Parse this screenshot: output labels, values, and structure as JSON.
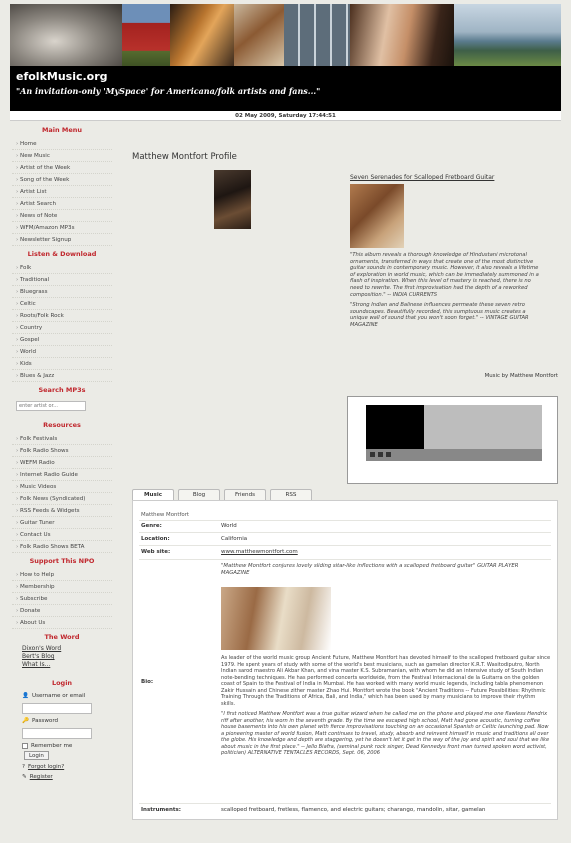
{
  "header": {
    "site_name": "efolkMusic.org",
    "tagline": "\"An invitation-only 'MySpace' for Americana/folk artists and fans...\"",
    "date": "02 May 2009, Saturday 17:44:51"
  },
  "sidebar": {
    "main_menu": {
      "title": "Main Menu",
      "items": [
        "Home",
        "New Music",
        "Artist of the Week",
        "Song of the Week",
        "Artist List",
        "Artist Search",
        "News of Note",
        "WFM/Amazon MP3s",
        "Newsletter Signup"
      ]
    },
    "listen": {
      "title": "Listen & Download",
      "items": [
        "Folk",
        "Traditional",
        "Bluegrass",
        "Celtic",
        "Roots/Folk Rock",
        "Country",
        "Gospel",
        "World",
        "Kids",
        "Blues & Jazz"
      ]
    },
    "search": {
      "title": "Search MP3s",
      "placeholder": "enter artist or..."
    },
    "resources": {
      "title": "Resources",
      "items": [
        "Folk Festivals",
        "Folk Radio Shows",
        "WEFM Radio",
        "Internet Radio Guide",
        "Music Videos",
        "Folk News (Syndicated)",
        "RSS Feeds & Widgets",
        "Guitar Tuner",
        "Contact Us",
        "Folk Radio Shows BETA"
      ]
    },
    "support": {
      "title": "Support This NPO",
      "items": [
        "How to Help",
        "Membership",
        "Subscribe",
        "Donate",
        "About Us"
      ]
    },
    "word": {
      "title": "The Word",
      "links": [
        "Dixon's Word",
        "Bert's Blog",
        "What Is..."
      ]
    },
    "login": {
      "title": "Login",
      "username_label": "Username or email",
      "password_label": "Password",
      "remember_label": "Remember me",
      "login_button": "Login",
      "forgot_label": "Forgot login?",
      "register_label": "Register"
    }
  },
  "profile": {
    "title": "Matthew Montfort Profile",
    "album": {
      "title": "Seven Serenades for Scalloped Fretboard Guitar",
      "review1": "\"This album reveals a thorough knowledge of Hindustani microtonal ornaments, transferred in ways that create one of the most distinctive guitar sounds in contemporary music. However, it also reveals a lifetime of exploration in world music, which can be immediately summoned in a flash of inspiration. When this level of mastery is reached, there is no need to rewrite. The first improvisation had the depth of a reworked composition.\" -- INDIA CURRENTS",
      "review2": "\"Strong Indian and Balinese influences permeate these seven retro soundscapes. Beautifully recorded, this sumptuous music creates a unique wall of sound that you won't soon forget.\" -- VINTAGE GUITAR MAGAZINE",
      "music_by": "Music by Matthew Montfort"
    }
  },
  "tabs": [
    "Music",
    "Blog",
    "Friends",
    "RSS"
  ],
  "details": {
    "artist_name": "Matthew Montfort",
    "genre_label": "Genre:",
    "genre": "World",
    "location_label": "Location:",
    "location": "California",
    "website_label": "Web site:",
    "website": "www.matthewmontfort.com",
    "bio_label": "Bio:",
    "bio_quote": "\"Matthew Montfort conjures lovely sliding sitar-like inflections with a scalloped fretboard guitar\" GUITAR PLAYER MAGAZINE",
    "bio_para1": "As leader of the world music group Ancient Future, Matthew Montfort has devoted himself to the scalloped fretboard guitar since 1979. He spent years of study with some of the world's best musicians, such as gamelan director K.R.T. Wasitodiputro, North Indian sarod maestro Ali Akbar Khan, and vina master K.S. Subramanian, with whom he did an intensive study of South Indian note-bending techniques. He has performed concerts worldwide, from the Festival Internacional de la Guitarra on the golden coast of Spain to the Festival of India in Mumbai. He has worked with many world music legends, including tabla phenomenon Zakir Hussain and Chinese zither master Zhao Hui. Montfort wrote the book \"Ancient Traditions -- Future Possibilities: Rhythmic Training Through the Traditions of Africa, Bali, and India,\" which has been used by many musicians to improve their rhythm skills.",
    "bio_para2": "\"I first noticed Matthew Montfort was a true guitar wizard when he called me on the phone and played me one flawless Hendrix riff after another, his worn in the seventh grade. By the time we escaped high school, Matt had gone acoustic, turning coffee house basements into his own planet with fierce improvisations touching on an occasional Spanish or Celtic launching pad. Now a pioneering master of world fusion, Matt continues to travel, study, absorb and reinvent himself in music and traditions all over the globe. His knowledge and depth are staggering, yet he doesn't let it get in the way of the joy and spirit and soul that we like about music in the first place.\" -- Jello Biafra, (seminal punk rock singer, Dead Kennedys front man turned spoken word activist, politician) ALTERNATIVE TENTACLES RECORDS, Sept. 06, 2006",
    "instruments_label": "Instruments:",
    "instruments": "scalloped fretboard, fretless, flamenco, and electric guitars; charango, mandolin, sitar, gamelan"
  },
  "colors": {
    "accent_red": "#c0272d",
    "header_black": "#000000",
    "page_bg": "#ebebe6"
  }
}
